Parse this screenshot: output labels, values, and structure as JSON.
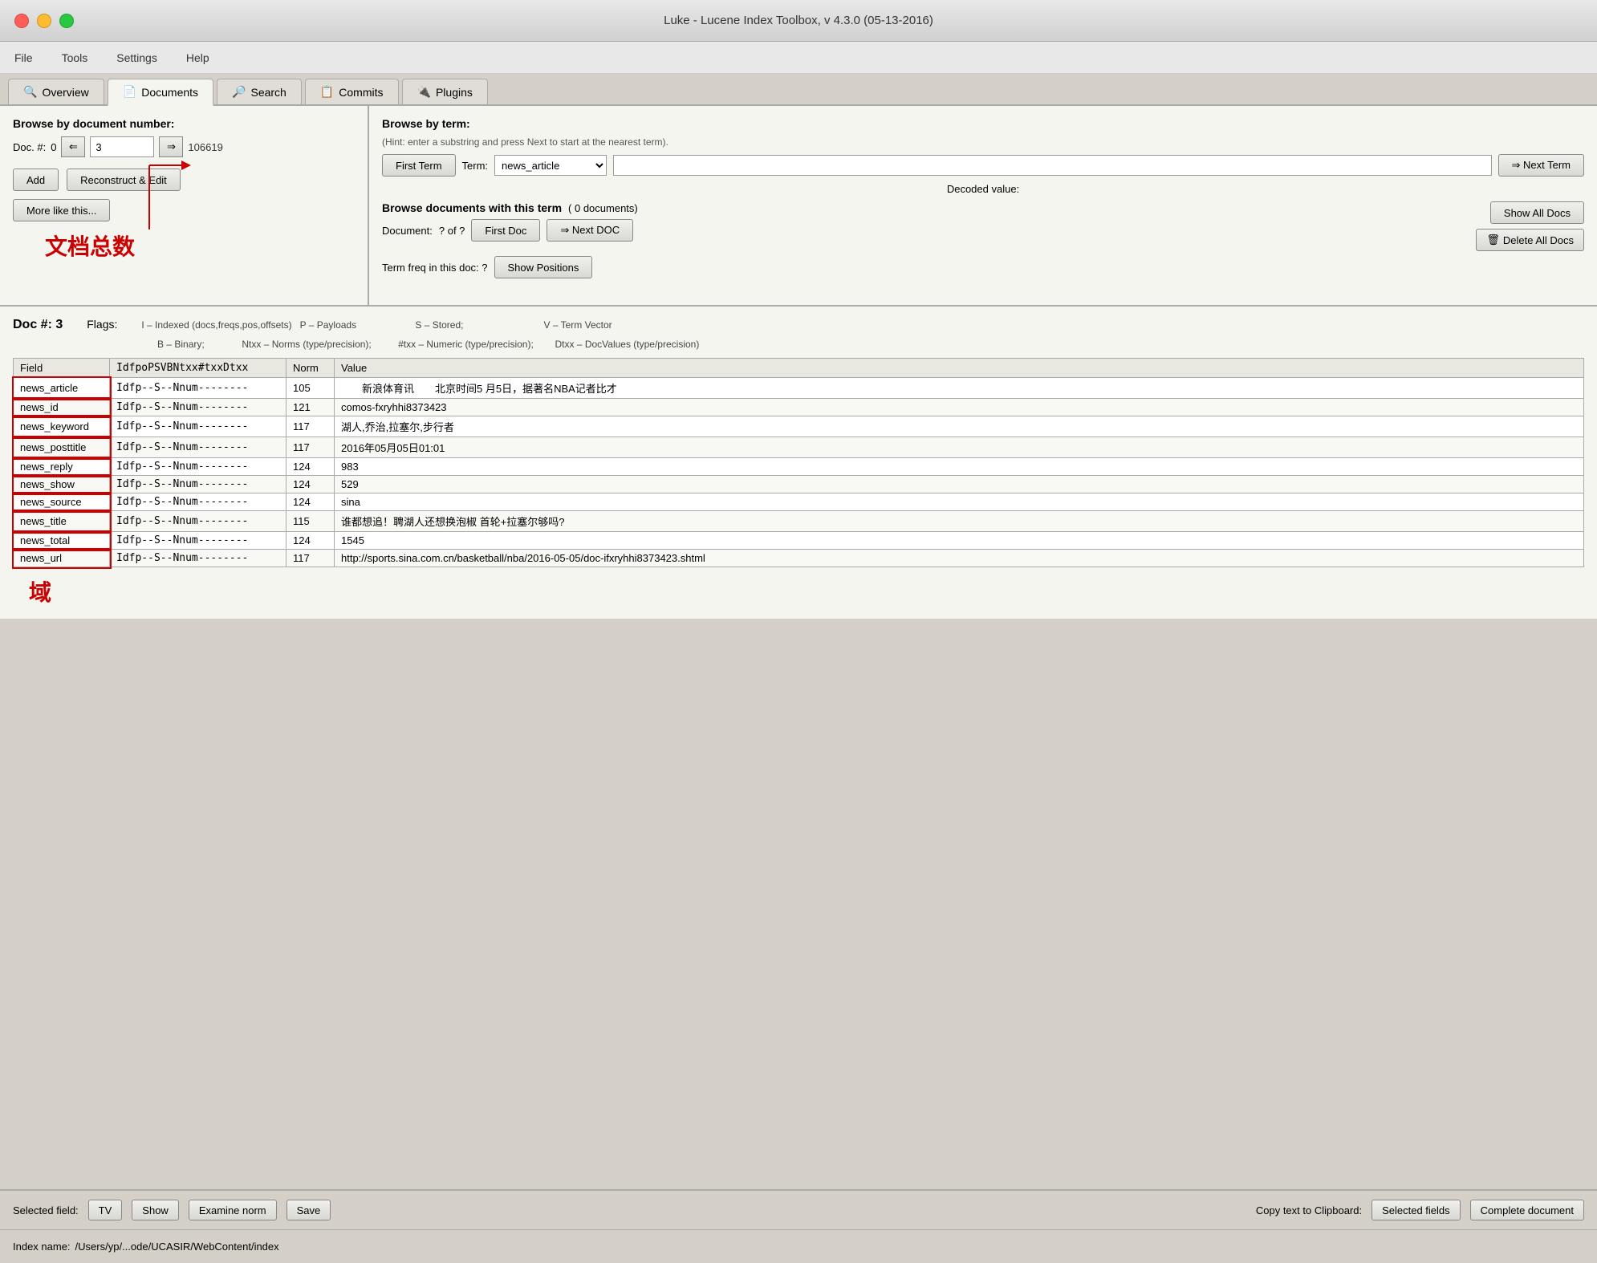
{
  "window": {
    "title": "Luke - Lucene Index Toolbox, v 4.3.0 (05-13-2016)"
  },
  "menu": {
    "items": [
      "File",
      "Tools",
      "Settings",
      "Help"
    ]
  },
  "tabs": [
    {
      "label": "Overview",
      "icon": "🔍",
      "active": false
    },
    {
      "label": "Documents",
      "icon": "📄",
      "active": true
    },
    {
      "label": "Search",
      "icon": "🔎",
      "active": false
    },
    {
      "label": "Commits",
      "icon": "📋",
      "active": false
    },
    {
      "label": "Plugins",
      "icon": "🔌",
      "active": false
    }
  ],
  "left_panel": {
    "title": "Browse by document number:",
    "doc_label": "Doc. #:",
    "doc_start": "0",
    "doc_current": "3",
    "doc_max": "106619",
    "add_label": "Add",
    "reconstruct_label": "Reconstruct & Edit",
    "more_like_label": "More like this...",
    "annotation_text": "文档总数",
    "annotation_sub": "域"
  },
  "right_panel": {
    "title": "Browse by term:",
    "hint": "(Hint: enter a substring and press Next to start at the nearest term).",
    "first_term_label": "First Term",
    "term_label": "Term:",
    "term_value": "news_article",
    "term_options": [
      "news_article",
      "news_id",
      "news_keyword",
      "news_posttitle",
      "news_reply",
      "news_show",
      "news_source",
      "news_title",
      "news_total",
      "news_url"
    ],
    "term_input": "",
    "next_term_label": "⇒ Next Term",
    "decoded_label": "Decoded value:",
    "browse_docs_title": "Browse documents with this term",
    "docs_count": "( 0 documents)",
    "document_label": "Document:",
    "document_of": "? of ?",
    "first_doc_label": "First Doc",
    "next_doc_label": "⇒ Next DOC",
    "show_all_label": "Show All Docs",
    "delete_all_label": "Delete All Docs",
    "term_freq_label": "Term freq in this doc: ?",
    "show_positions_label": "Show Positions"
  },
  "doc_section": {
    "doc_num": "Doc #: 3",
    "flags_label": "Flags:",
    "flags_legend": [
      "I – Indexed (docs,freqs,pos,offsets)",
      "P – Payloads",
      "S – Stored;",
      "V – Term Vector",
      "B – Binary;",
      "Ntxx – Norms (type/precision);",
      "#txx – Numeric (type/precision);",
      "Dtxx – DocValues (type/precision)"
    ],
    "table_headers": [
      "Field",
      "IdfpoPSVBNtxx#txxDtxx",
      "Norm",
      "Value"
    ],
    "rows": [
      {
        "field": "news_article",
        "flags": "Idfp--S--Nnum--------",
        "norm": "105",
        "value": "　　新浪体育讯　　北京时间5 月5日，据著名NBA记者比才"
      },
      {
        "field": "news_id",
        "flags": "Idfp--S--Nnum--------",
        "norm": "121",
        "value": "comos-fxryhhi8373423"
      },
      {
        "field": "news_keyword",
        "flags": "Idfp--S--Nnum--------",
        "norm": "117",
        "value": "湖人,乔治,拉塞尔,步行者"
      },
      {
        "field": "news_posttitle",
        "flags": "Idfp--S--Nnum--------",
        "norm": "117",
        "value": "2016年05月05日01:01"
      },
      {
        "field": "news_reply",
        "flags": "Idfp--S--Nnum--------",
        "norm": "124",
        "value": "983"
      },
      {
        "field": "news_show",
        "flags": "Idfp--S--Nnum--------",
        "norm": "124",
        "value": "529"
      },
      {
        "field": "news_source",
        "flags": "Idfp--S--Nnum--------",
        "norm": "124",
        "value": "sina"
      },
      {
        "field": "news_title",
        "flags": "Idfp--S--Nnum--------",
        "norm": "115",
        "value": "谁都想追！聘湖人还想换泡椒 首轮+拉塞尔够吗?"
      },
      {
        "field": "news_total",
        "flags": "Idfp--S--Nnum--------",
        "norm": "124",
        "value": "1545"
      },
      {
        "field": "news_url",
        "flags": "Idfp--S--Nnum--------",
        "norm": "117",
        "value": "http://sports.sina.com.cn/basketball/nba/2016-05-05/doc-ifxryhhi8373423.shtml"
      }
    ]
  },
  "bottom_bar": {
    "selected_field_label": "Selected field:",
    "tv_label": "TV",
    "show_label": "Show",
    "examine_norm_label": "Examine norm",
    "save_label": "Save",
    "copy_label": "Copy text to Clipboard:",
    "selected_fields_label": "Selected fields",
    "complete_doc_label": "Complete document"
  },
  "status_bar": {
    "index_label": "Index name:",
    "index_path": "/Users/yp/...ode/UCASIR/WebContent/index"
  }
}
